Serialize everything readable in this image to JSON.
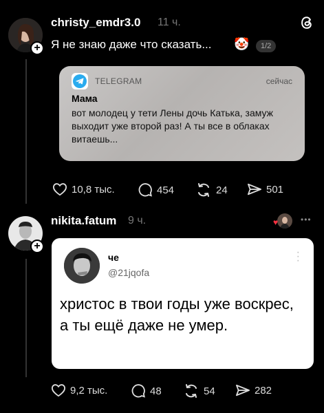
{
  "post1": {
    "username": "christy_emdr3.0",
    "time": "11 ч.",
    "text": "Я не знаю даже что сказать...",
    "emoji": "🤡",
    "carousel_badge": "1/2",
    "threads_icon": "threads-logo-icon",
    "notification": {
      "app": "TELEGRAM",
      "time": "сейчас",
      "from": "Мама",
      "message": "вот молодец у тети Лены дочь Катька, замуж выходит уже второй раз! А ты все в облаках витаешь..."
    },
    "actions": {
      "likes": "10,8 тыс.",
      "comments": "454",
      "reposts": "24",
      "shares": "501"
    }
  },
  "post2": {
    "username": "nikita.fatum",
    "time": "9 ч.",
    "more": "•••",
    "quote": {
      "name": "че",
      "handle": "@21jqofa",
      "text": "христос в твои годы уже воскрес, а ты ещё даже не умер."
    },
    "actions": {
      "likes": "9,2 тыс.",
      "comments": "48",
      "reposts": "54",
      "shares": "282"
    }
  },
  "colors": {
    "background": "#000000",
    "muted": "#777777",
    "telegram_blue": "#2AABEE"
  }
}
